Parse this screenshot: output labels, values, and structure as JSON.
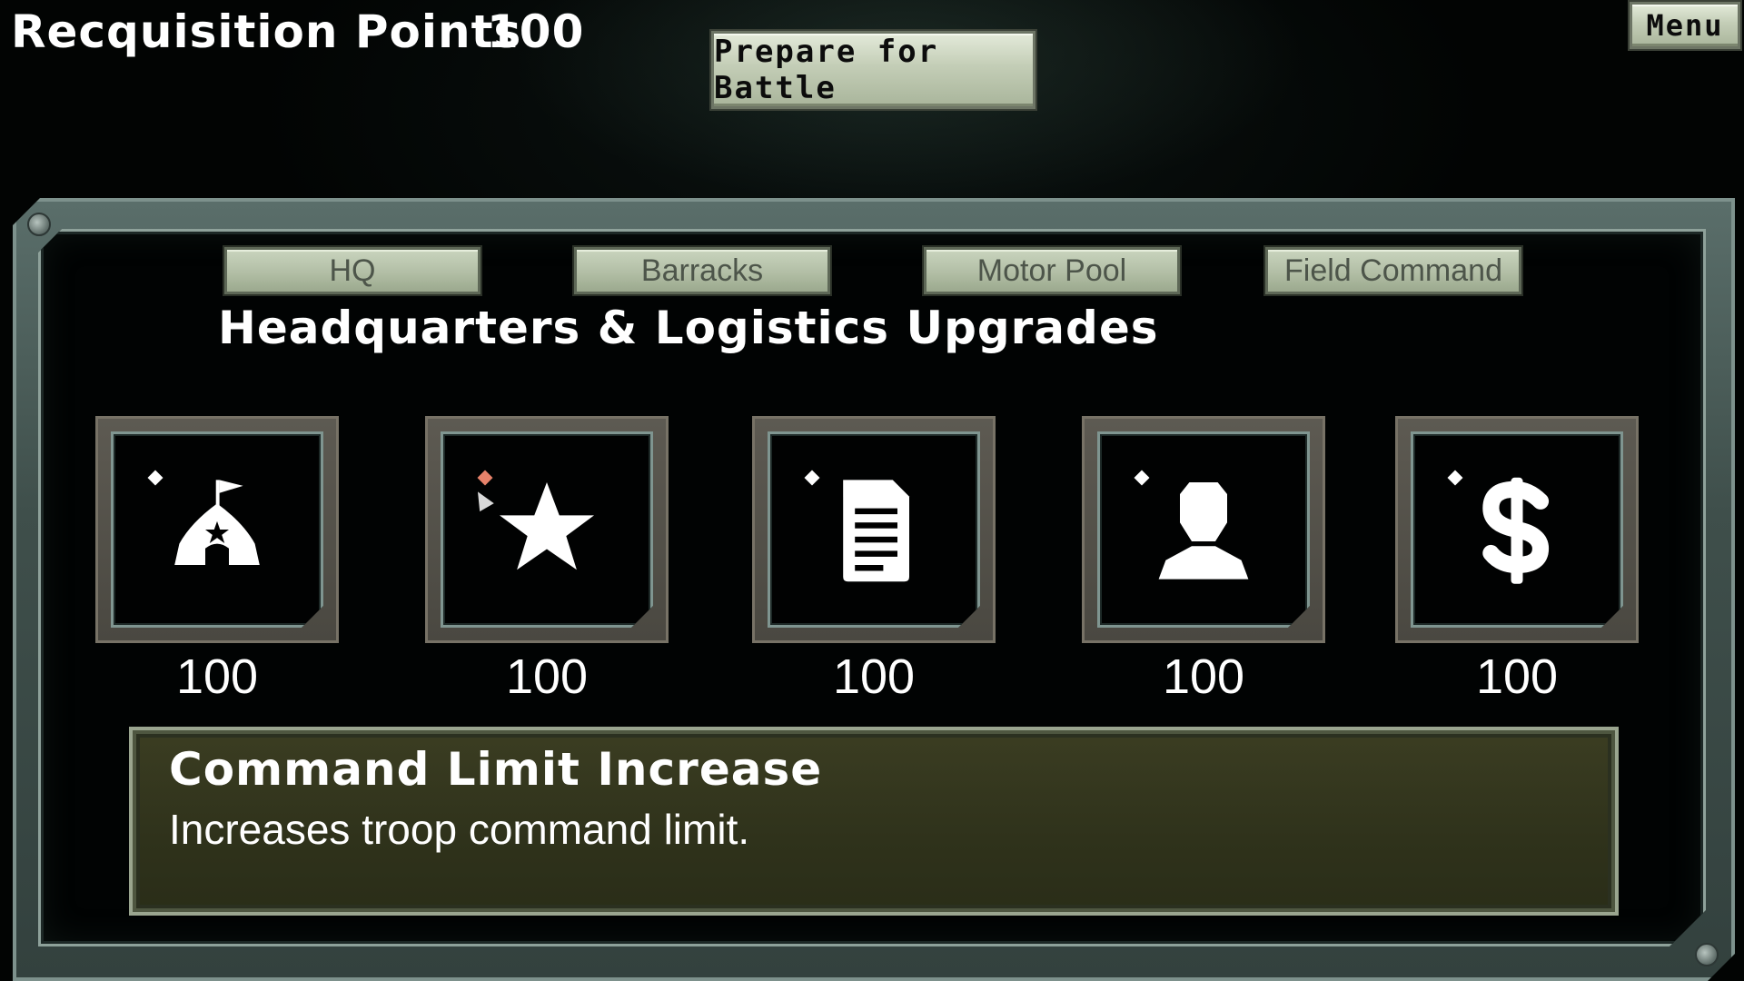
{
  "top_bar": {
    "rp_label": "Recquisition Points",
    "rp_value": "100",
    "battle_label": "Prepare for Battle",
    "menu_label": "Menu"
  },
  "tabs": [
    {
      "label": "HQ"
    },
    {
      "label": "Barracks"
    },
    {
      "label": "Motor Pool"
    },
    {
      "label": "Field Command"
    }
  ],
  "section_title": "Headquarters & Logistics Upgrades",
  "upgrades": [
    {
      "icon": "hq-tent-icon",
      "cost": "100"
    },
    {
      "icon": "star-icon",
      "cost": "100",
      "selected": true
    },
    {
      "icon": "document-icon",
      "cost": "100"
    },
    {
      "icon": "person-icon",
      "cost": "100"
    },
    {
      "icon": "dollar-icon",
      "cost": "100"
    }
  ],
  "description": {
    "title": "Command Limit Increase",
    "text": "Increases troop command limit."
  },
  "colors": {
    "background": "#020403",
    "frame": "#5a6e6a",
    "panel": "#2f321b",
    "button": "#c3cdb6",
    "selected_diamond": "#e7826a"
  }
}
